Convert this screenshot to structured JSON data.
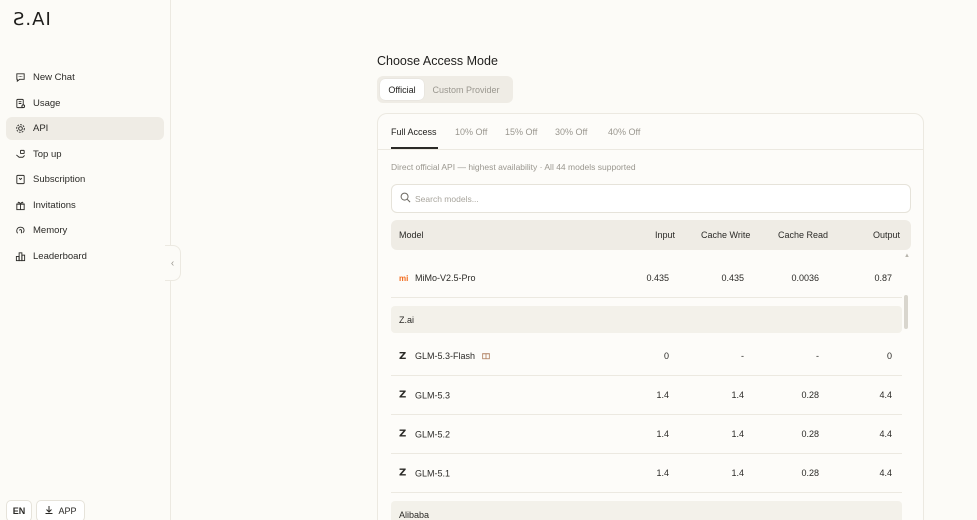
{
  "logo": "Ƨ.AI",
  "sidebar": {
    "items": [
      {
        "label": "New Chat",
        "icon": "chat-icon"
      },
      {
        "label": "Usage",
        "icon": "usage-icon"
      },
      {
        "label": "API",
        "icon": "api-icon"
      },
      {
        "label": "Top up",
        "icon": "topup-icon"
      },
      {
        "label": "Subscription",
        "icon": "subscription-icon"
      },
      {
        "label": "Invitations",
        "icon": "gift-icon"
      },
      {
        "label": "Memory",
        "icon": "memory-icon"
      },
      {
        "label": "Leaderboard",
        "icon": "leaderboard-icon"
      }
    ],
    "active": "API",
    "lang_label": "EN",
    "app_label": "APP"
  },
  "main": {
    "title": "Choose Access Mode",
    "modes": [
      "Official",
      "Custom Provider"
    ],
    "tabs": [
      "Full Access",
      "10% Off",
      "15% Off",
      "30% Off",
      "40% Off"
    ],
    "description": "Direct official API — highest availability · All 44 models supported",
    "search_placeholder": "Search models...",
    "columns": [
      "Model",
      "Input",
      "Cache Write",
      "Cache Read",
      "Output"
    ],
    "rows": [
      {
        "type": "model",
        "brand": "mi",
        "name": "MiMo-V2.5-Pro",
        "input": "0.435",
        "cache_write": "0.435",
        "cache_read": "0.0036",
        "output": "0.87"
      },
      {
        "type": "group",
        "name": "Z.ai"
      },
      {
        "type": "model",
        "brand": "z",
        "name": "GLM-5.3-Flash",
        "gift": true,
        "input": "0",
        "cache_write": "-",
        "cache_read": "-",
        "output": "0"
      },
      {
        "type": "model",
        "brand": "z",
        "name": "GLM-5.3",
        "input": "1.4",
        "cache_write": "1.4",
        "cache_read": "0.28",
        "output": "4.4"
      },
      {
        "type": "model",
        "brand": "z",
        "name": "GLM-5.2",
        "input": "1.4",
        "cache_write": "1.4",
        "cache_read": "0.28",
        "output": "4.4"
      },
      {
        "type": "model",
        "brand": "z",
        "name": "GLM-5.1",
        "input": "1.4",
        "cache_write": "1.4",
        "cache_read": "0.28",
        "output": "4.4"
      },
      {
        "type": "group",
        "name": "Alibaba"
      }
    ]
  }
}
